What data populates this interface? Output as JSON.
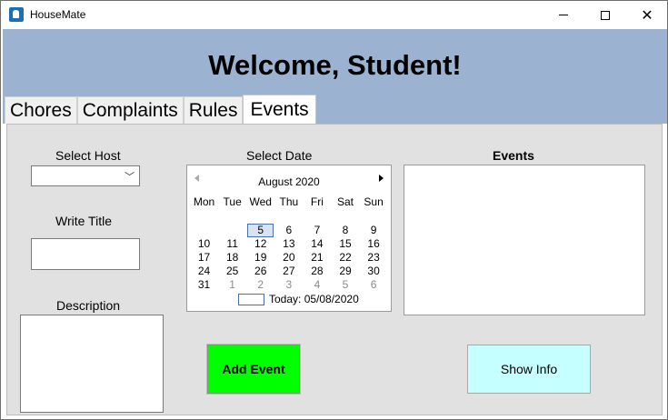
{
  "window": {
    "title": "HouseMate",
    "controls": {
      "minimize": "minimize",
      "maximize": "maximize",
      "close": "✕"
    }
  },
  "header": {
    "welcome": "Welcome, Student!"
  },
  "tabs": [
    {
      "label": "Chores"
    },
    {
      "label": "Complaints"
    },
    {
      "label": "Rules"
    },
    {
      "label": "Events",
      "active": true
    }
  ],
  "form": {
    "select_host_label": "Select Host",
    "select_host_value": "",
    "write_title_label": "Write Title",
    "title_value": "",
    "description_label": "Description",
    "description_value": "",
    "select_date_label": "Select Date",
    "events_label": "Events"
  },
  "calendar": {
    "month": "August 2020",
    "weekdays": [
      "Mon",
      "Tue",
      "Wed",
      "Thu",
      "Fri",
      "Sat",
      "Sun"
    ],
    "weeks": [
      [
        "",
        "",
        "5",
        "6",
        "7",
        "8",
        "9"
      ],
      [
        "10",
        "11",
        "12",
        "13",
        "14",
        "15",
        "16"
      ],
      [
        "17",
        "18",
        "19",
        "20",
        "21",
        "22",
        "23"
      ],
      [
        "24",
        "25",
        "26",
        "27",
        "28",
        "29",
        "30"
      ],
      [
        "31",
        "1",
        "2",
        "3",
        "4",
        "5",
        "6"
      ]
    ],
    "selected_day": "5",
    "today_text": "Today: 05/08/2020"
  },
  "buttons": {
    "add_event": "Add Event",
    "show_info": "Show Info"
  },
  "colors": {
    "header_bg": "#9bb3d0",
    "add_event_bg": "#00ff00",
    "show_info_bg": "#c6ffff",
    "panel_bg": "#e1e1e1"
  }
}
